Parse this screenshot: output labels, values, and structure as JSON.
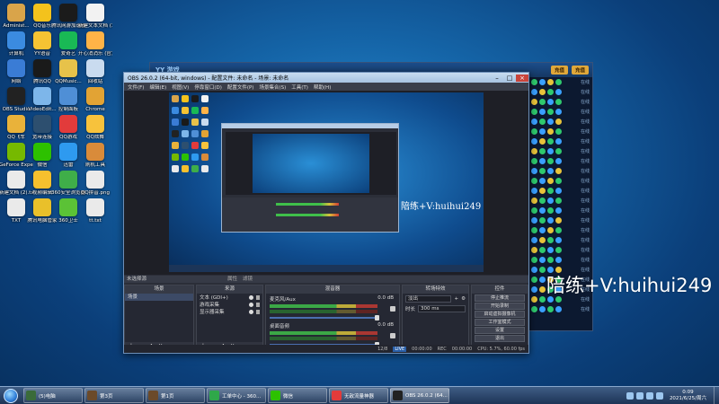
{
  "desktop": {
    "icons": [
      {
        "label": "Administ...",
        "color": "#d9a44a"
      },
      {
        "label": "QQ音乐",
        "color": "#f4c21c"
      },
      {
        "label": "腾讯网游加速器",
        "color": "#1b1b1b"
      },
      {
        "label": "新建文本文档 (3).txt",
        "color": "#f2f2f2"
      },
      {
        "label": "计算机",
        "color": "#3b8be0"
      },
      {
        "label": "YY语音",
        "color": "#f5c333"
      },
      {
        "label": "爱奇艺",
        "color": "#19b955"
      },
      {
        "label": "开心消消乐 (官方版).exe",
        "color": "#ffb347"
      },
      {
        "label": "网络",
        "color": "#3a7cd5"
      },
      {
        "label": "腾讯QQ",
        "color": "#1a1a1a"
      },
      {
        "label": "QQMusic...",
        "color": "#e7c24a"
      },
      {
        "label": "回收站",
        "color": "#c9dbef"
      },
      {
        "label": "OBS Studio",
        "color": "#222222"
      },
      {
        "label": "VideoEdit...",
        "color": "#7db6ea"
      },
      {
        "label": "控制面板",
        "color": "#4f8fd6"
      },
      {
        "label": "Chrome",
        "color": "#e2a334"
      },
      {
        "label": "QQ飞车",
        "color": "#e9b23a"
      },
      {
        "label": "宽带连接",
        "color": "#2d4f6f"
      },
      {
        "label": "QQ游戏",
        "color": "#e23b3b"
      },
      {
        "label": "QQ炫舞",
        "color": "#f7c23c"
      },
      {
        "label": "GeForce Experience",
        "color": "#76b900"
      },
      {
        "label": "微信",
        "color": "#2dc100"
      },
      {
        "label": "迅雷",
        "color": "#2e9af0"
      },
      {
        "label": "刷机工具",
        "color": "#d98b3a"
      },
      {
        "label": "新建文档 (2).txt",
        "color": "#eaeaea"
      },
      {
        "label": "视频编辑",
        "color": "#f6c02e"
      },
      {
        "label": "360安全浏览器",
        "color": "#3fae49"
      },
      {
        "label": "QQ拼音.png",
        "color": "#eaeaea"
      },
      {
        "label": "TXT",
        "color": "#eaeaea"
      },
      {
        "label": "腾讯电脑管家",
        "color": "#e9c02a"
      },
      {
        "label": "360卫士",
        "color": "#5bc236"
      },
      {
        "label": "tt.txt",
        "color": "#eaeaea"
      }
    ]
  },
  "game_window": {
    "title": "YY 游戏",
    "buttons": [
      "充值",
      "充值"
    ],
    "sidebar_status": [
      "在线",
      "在线",
      "在线",
      "在线",
      "在线",
      "在线",
      "在线",
      "在线",
      "在线",
      "在线",
      "在线",
      "在线",
      "在线",
      "在线",
      "在线",
      "在线",
      "在线",
      "在线",
      "在线",
      "在线",
      "在线",
      "在线",
      "在线",
      "在线"
    ]
  },
  "obs": {
    "title": "OBS 26.0.2 (64-bit, windows) - 配置文件: 未命名 - 场景: 未命名",
    "menu": [
      "文件(F)",
      "编辑(E)",
      "视图(V)",
      "停靠窗口(D)",
      "配置文件(P)",
      "场景集合(S)",
      "工具(T)",
      "帮助(H)"
    ],
    "watermark_small": "陪练+V:huihui249",
    "scene_bar_label": "未选择源",
    "scene_bar_tools": [
      "属性",
      "滤镜"
    ],
    "panels": {
      "scenes": {
        "title": "场景",
        "items": [
          "场景"
        ]
      },
      "sources": {
        "title": "来源",
        "items": [
          "文本 (GDI+)",
          "游戏采集",
          "显示器采集"
        ]
      },
      "mixer": {
        "title": "混音器",
        "tracks": [
          {
            "name": "麦克风/Aux",
            "db": "0.0 dB"
          },
          {
            "name": "桌面音频",
            "db": "0.0 dB"
          }
        ]
      },
      "transitions": {
        "title": "转场特效",
        "type": "淡出",
        "duration_label": "时长",
        "duration": "300 ms"
      },
      "controls": {
        "title": "控件",
        "buttons": [
          "停止推流",
          "开始录制",
          "启动虚拟摄像机",
          "工作室模式",
          "设置",
          "退出"
        ]
      }
    },
    "status": {
      "live_tag": "LIVE",
      "live_time": "00:00:00",
      "rec_tag": "REC",
      "rec_time": "00:00:00",
      "cpu": "CPU: 5.7%, 60.00 fps",
      "dropped": "12/8"
    },
    "footer_buttons": [
      "+",
      "—",
      "∧",
      "∨"
    ]
  },
  "watermark": "陪练+V:huihui249",
  "taskbar": {
    "items": [
      {
        "label": "(5)电脑",
        "color": "#3a6b3a"
      },
      {
        "label": "第3页",
        "color": "#6b4a2a"
      },
      {
        "label": "第1页",
        "color": "#6b4a2a"
      },
      {
        "label": "工单中心 - 360...",
        "color": "#2fa84a"
      },
      {
        "label": "微信",
        "color": "#2dc100"
      },
      {
        "label": "无敌流量神器",
        "color": "#e23b3b"
      },
      {
        "label": "OBS 26.0.2 (64...",
        "color": "#222222"
      }
    ],
    "clock_time": "0:09",
    "clock_date": "2021/6/25/周六"
  }
}
